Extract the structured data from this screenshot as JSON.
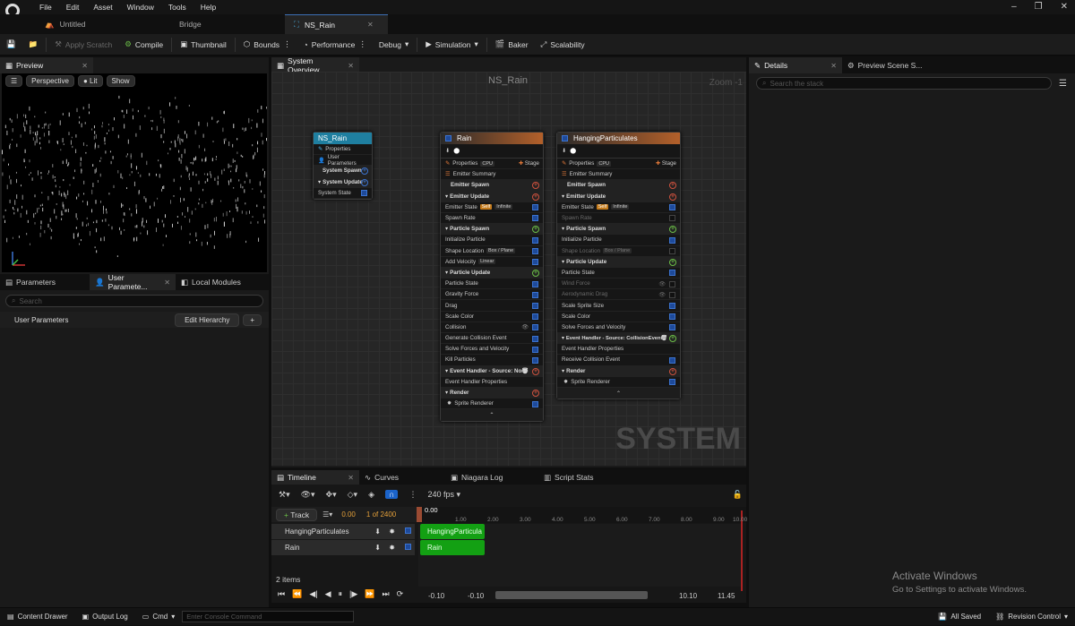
{
  "menu": [
    "File",
    "Edit",
    "Asset",
    "Window",
    "Tools",
    "Help"
  ],
  "tabs": [
    {
      "label": "Untitled"
    },
    {
      "label": "Bridge"
    },
    {
      "label": "NS_Rain"
    }
  ],
  "toolbar": {
    "apply_scratch": "Apply Scratch",
    "compile": "Compile",
    "thumbnail": "Thumbnail",
    "bounds": "Bounds",
    "performance": "Performance",
    "debug": "Debug",
    "simulation": "Simulation",
    "baker": "Baker",
    "scalability": "Scalability"
  },
  "preview": {
    "tab": "Preview",
    "perspective": "Perspective",
    "lit": "Lit",
    "show": "Show"
  },
  "params": {
    "tab_parameters": "Parameters",
    "tab_user": "User Paramete...",
    "tab_local": "Local Modules",
    "search_placeholder": "Search",
    "user_params": "User Parameters",
    "edit_hierarchy": "Edit Hierarchy",
    "add": "+"
  },
  "overview": {
    "tab": "System Overview",
    "title": "NS_Rain",
    "zoom": "Zoom -1",
    "watermark": "SYSTEM"
  },
  "system_node": {
    "title": "NS_Rain",
    "rows": [
      "Properties",
      "User Parameters",
      "System Spawn",
      "System Update",
      "System State"
    ]
  },
  "rain_node": {
    "title": "Rain",
    "properties": "Properties",
    "stage": "Stage",
    "emitter_summary": "Emitter Summary",
    "emitter_spawn": "Emitter Spawn",
    "emitter_update": "Emitter Update",
    "emitter_state": "Emitter State",
    "self": "Self",
    "infinite": "Infinite",
    "spawn_rate": "Spawn Rate",
    "particle_spawn": "Particle Spawn",
    "init_particle": "Initialize Particle",
    "shape_location": "Shape Location",
    "box_plane": "Box / Plane",
    "add_velocity": "Add Velocity",
    "linear": "Linear",
    "particle_update": "Particle Update",
    "particle_state": "Particle State",
    "gravity": "Gravity Force",
    "drag": "Drag",
    "scale_color": "Scale Color",
    "collision": "Collision",
    "gen_collision": "Generate Collision Event",
    "solve_forces": "Solve Forces and Velocity",
    "kill_particles": "Kill Particles",
    "event_handler": "Event Handler - Source: None",
    "event_props": "Event Handler Properties",
    "render": "Render",
    "sprite_renderer": "Sprite Renderer"
  },
  "hp_node": {
    "title": "HangingParticulates",
    "properties": "Properties",
    "stage": "Stage",
    "emitter_summary": "Emitter Summary",
    "emitter_spawn": "Emitter Spawn",
    "emitter_update": "Emitter Update",
    "emitter_state": "Emitter State",
    "self": "Self",
    "infinite": "Infinite",
    "spawn_rate": "Spawn Rate",
    "particle_spawn": "Particle Spawn",
    "init_particle": "Initialize Particle",
    "shape_location": "Shape Location",
    "box_plane": "Box / Plane",
    "particle_update": "Particle Update",
    "particle_state": "Particle State",
    "wind_force": "Wind Force",
    "aero_drag": "Aerodynamic Drag",
    "scale_sprite": "Scale Sprite Size",
    "scale_color": "Scale Color",
    "solve_forces": "Solve Forces and Velocity",
    "event_handler": "Event Handler - Source: CollisionEvent",
    "event_props": "Event Handler Properties",
    "receive_collision": "Receive Collision Event",
    "render": "Render",
    "sprite_renderer": "Sprite Renderer"
  },
  "details": {
    "tab": "Details",
    "tab2": "Preview Scene S...",
    "search_placeholder": "Search the stack"
  },
  "timeline": {
    "tabs": [
      "Timeline",
      "Curves",
      "Niagara Log",
      "Script Stats"
    ],
    "fps": "240 fps",
    "track": "Track",
    "time": "0.00",
    "frame": "1 of 2400",
    "playhead": "0.00",
    "ticks": [
      "1.00",
      "2.00",
      "3.00",
      "4.00",
      "5.00",
      "6.00",
      "7.00",
      "8.00",
      "9.00",
      "10.00"
    ],
    "tracks": [
      "HangingParticulates",
      "Rain"
    ],
    "clips": [
      "HangingParticula",
      "Rain"
    ],
    "count": "2 items",
    "range_start": "-0.10",
    "range_start2": "-0.10",
    "range_end": "10.10",
    "range_end2": "11.45"
  },
  "status": {
    "content_drawer": "Content Drawer",
    "output_log": "Output Log",
    "cmd": "Cmd",
    "console_placeholder": "Enter Console Command",
    "all_saved": "All Saved",
    "revision": "Revision Control"
  },
  "activate": {
    "title": "Activate Windows",
    "subtitle": "Go to Settings to activate Windows."
  }
}
